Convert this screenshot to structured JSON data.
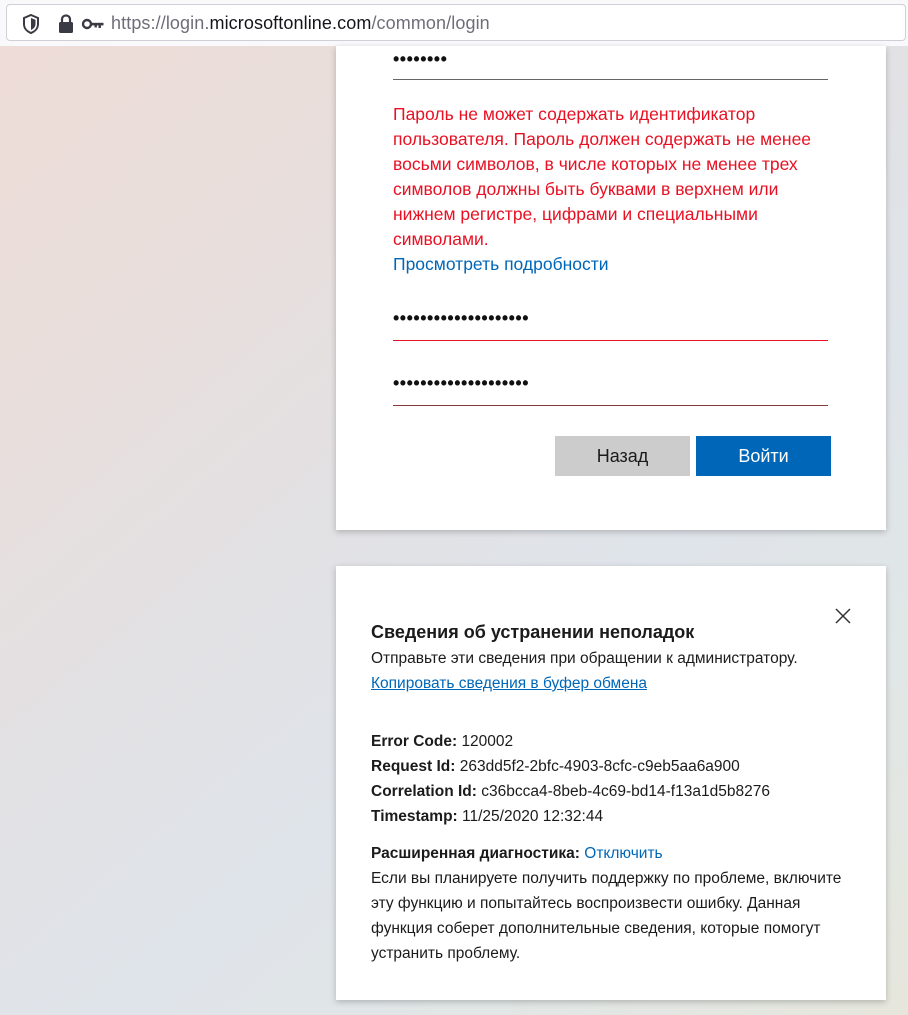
{
  "browser": {
    "url_prefix": "https://login.",
    "url_host": "microsoftonline.com",
    "url_path": "/common/login"
  },
  "login": {
    "current_password_mask": "••••••••",
    "error_message": "Пароль не может содержать идентификатор пользователя. Пароль должен содержать не менее восьми символов, в числе которых не менее трех символов должны быть буквами в верхнем или нижнем регистре, цифрами и специальными символами.",
    "details_link": "Просмотреть подробности",
    "new_password_mask": "••••••••••••••••••••",
    "confirm_password_mask": "••••••••••••••••••••",
    "back_label": "Назад",
    "signin_label": "Войти",
    "colors": {
      "error": "#e81123",
      "accent": "#0067b8",
      "field_error_line": "#e81123",
      "field_line": "#666666"
    }
  },
  "troubleshoot": {
    "title": "Сведения об устранении неполадок",
    "subtitle": "Отправьте эти сведения при обращении к администратору.",
    "copy_link": "Копировать сведения в буфер обмена",
    "error_code_label": "Error Code:",
    "error_code": "120002",
    "request_id_label": "Request Id:",
    "request_id": "263dd5f2-2bfc-4903-8cfc-c9eb5aa6a900",
    "correlation_id_label": "Correlation Id:",
    "correlation_id": "c36bcca4-8beb-4c69-bd14-f13a1d5b8276",
    "timestamp_label": "Timestamp:",
    "timestamp": "11/25/2020 12:32:44",
    "diag_label": "Расширенная диагностика:",
    "diag_link": "Отключить",
    "diag_text": "Если вы планируете получить поддержку по проблеме, включите эту функцию и попытайтесь воспроизвести ошибку. Данная функция соберет дополнительные сведения, которые помогут устранить проблему."
  }
}
